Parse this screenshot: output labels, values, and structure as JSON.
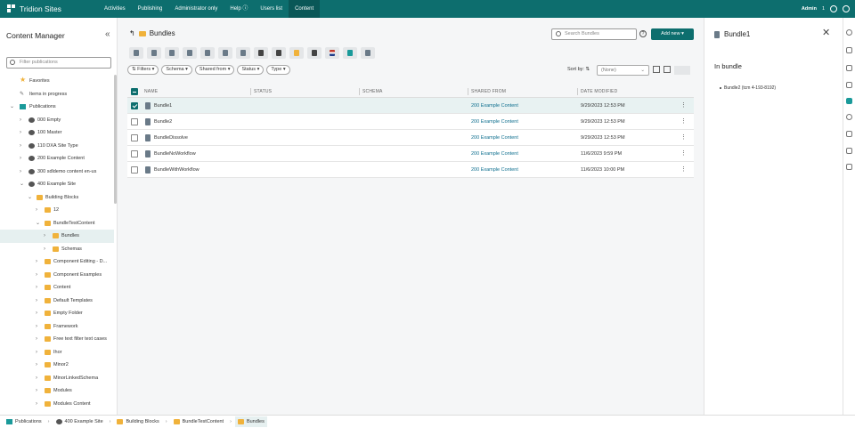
{
  "app": {
    "title": "Tridion Sites"
  },
  "nav": [
    "Activities",
    "Publishing",
    "Administrator only",
    "Help",
    "Users list",
    "Content"
  ],
  "user": {
    "name": "Admin",
    "count": "1"
  },
  "left_panel": {
    "title": "Content Manager",
    "filter_placeholder": "Filter publications",
    "tree": [
      {
        "label": "Favorites"
      },
      {
        "label": "Items in progress"
      },
      {
        "label": "Publications"
      },
      {
        "label": "000 Empty"
      },
      {
        "label": "100 Master"
      },
      {
        "label": "110 DXA Site Type"
      },
      {
        "label": "200 Example Content"
      },
      {
        "label": "300 sdldemo content en-us"
      },
      {
        "label": "400 Example Site"
      },
      {
        "label": "Building Blocks"
      },
      {
        "label": "12"
      },
      {
        "label": "BundleTestContent"
      },
      {
        "label": "Bundles"
      },
      {
        "label": "Schemas"
      },
      {
        "label": "Component Editing - D..."
      },
      {
        "label": "Component Examples"
      },
      {
        "label": "Content"
      },
      {
        "label": "Default Templates"
      },
      {
        "label": "Empty Folder"
      },
      {
        "label": "Framework"
      },
      {
        "label": "Free text filter text cases"
      },
      {
        "label": "Ihor"
      },
      {
        "label": "Minor2"
      },
      {
        "label": "MinorLinkedSchema"
      },
      {
        "label": "Modules"
      },
      {
        "label": "Modules Content"
      }
    ]
  },
  "main": {
    "heading": "Bundles",
    "search_placeholder": "Search Bundles",
    "add_new": "Add new",
    "filters": [
      "Filters",
      "Schema",
      "Shared from",
      "Status",
      "Type"
    ],
    "sort_label": "Sort by:",
    "sort_value": "(None)",
    "columns": [
      "NAME",
      "STATUS",
      "SCHEMA",
      "SHARED FROM",
      "DATE MODIFIED"
    ],
    "rows": [
      {
        "name": "Bundle1",
        "shared_from": "200 Example Content",
        "date": "9/29/2023 12:53 PM",
        "selected": true
      },
      {
        "name": "Bundle2",
        "shared_from": "200 Example Content",
        "date": "9/29/2023 12:53 PM",
        "selected": false
      },
      {
        "name": "BundleDissolve",
        "shared_from": "200 Example Content",
        "date": "9/29/2023 12:53 PM",
        "selected": false
      },
      {
        "name": "BundleNoWorkflow",
        "shared_from": "200 Example Content",
        "date": "11/6/2023 9:59 PM",
        "selected": false
      },
      {
        "name": "BundleWithWorkflow",
        "shared_from": "200 Example Content",
        "date": "11/6/2023 10:00 PM",
        "selected": false
      }
    ]
  },
  "right_panel": {
    "title": "Bundle1",
    "subtitle": "In bundle",
    "items": [
      "Bundle2 (tcm 4-193-8192)"
    ]
  },
  "breadcrumb": [
    "Publications",
    "400 Example Site",
    "Building Blocks",
    "BundleTestContent",
    "Bundles"
  ],
  "colors": {
    "brand": "#0d6e6e",
    "folder": "#f0b23b",
    "link": "#0d6e8e"
  }
}
